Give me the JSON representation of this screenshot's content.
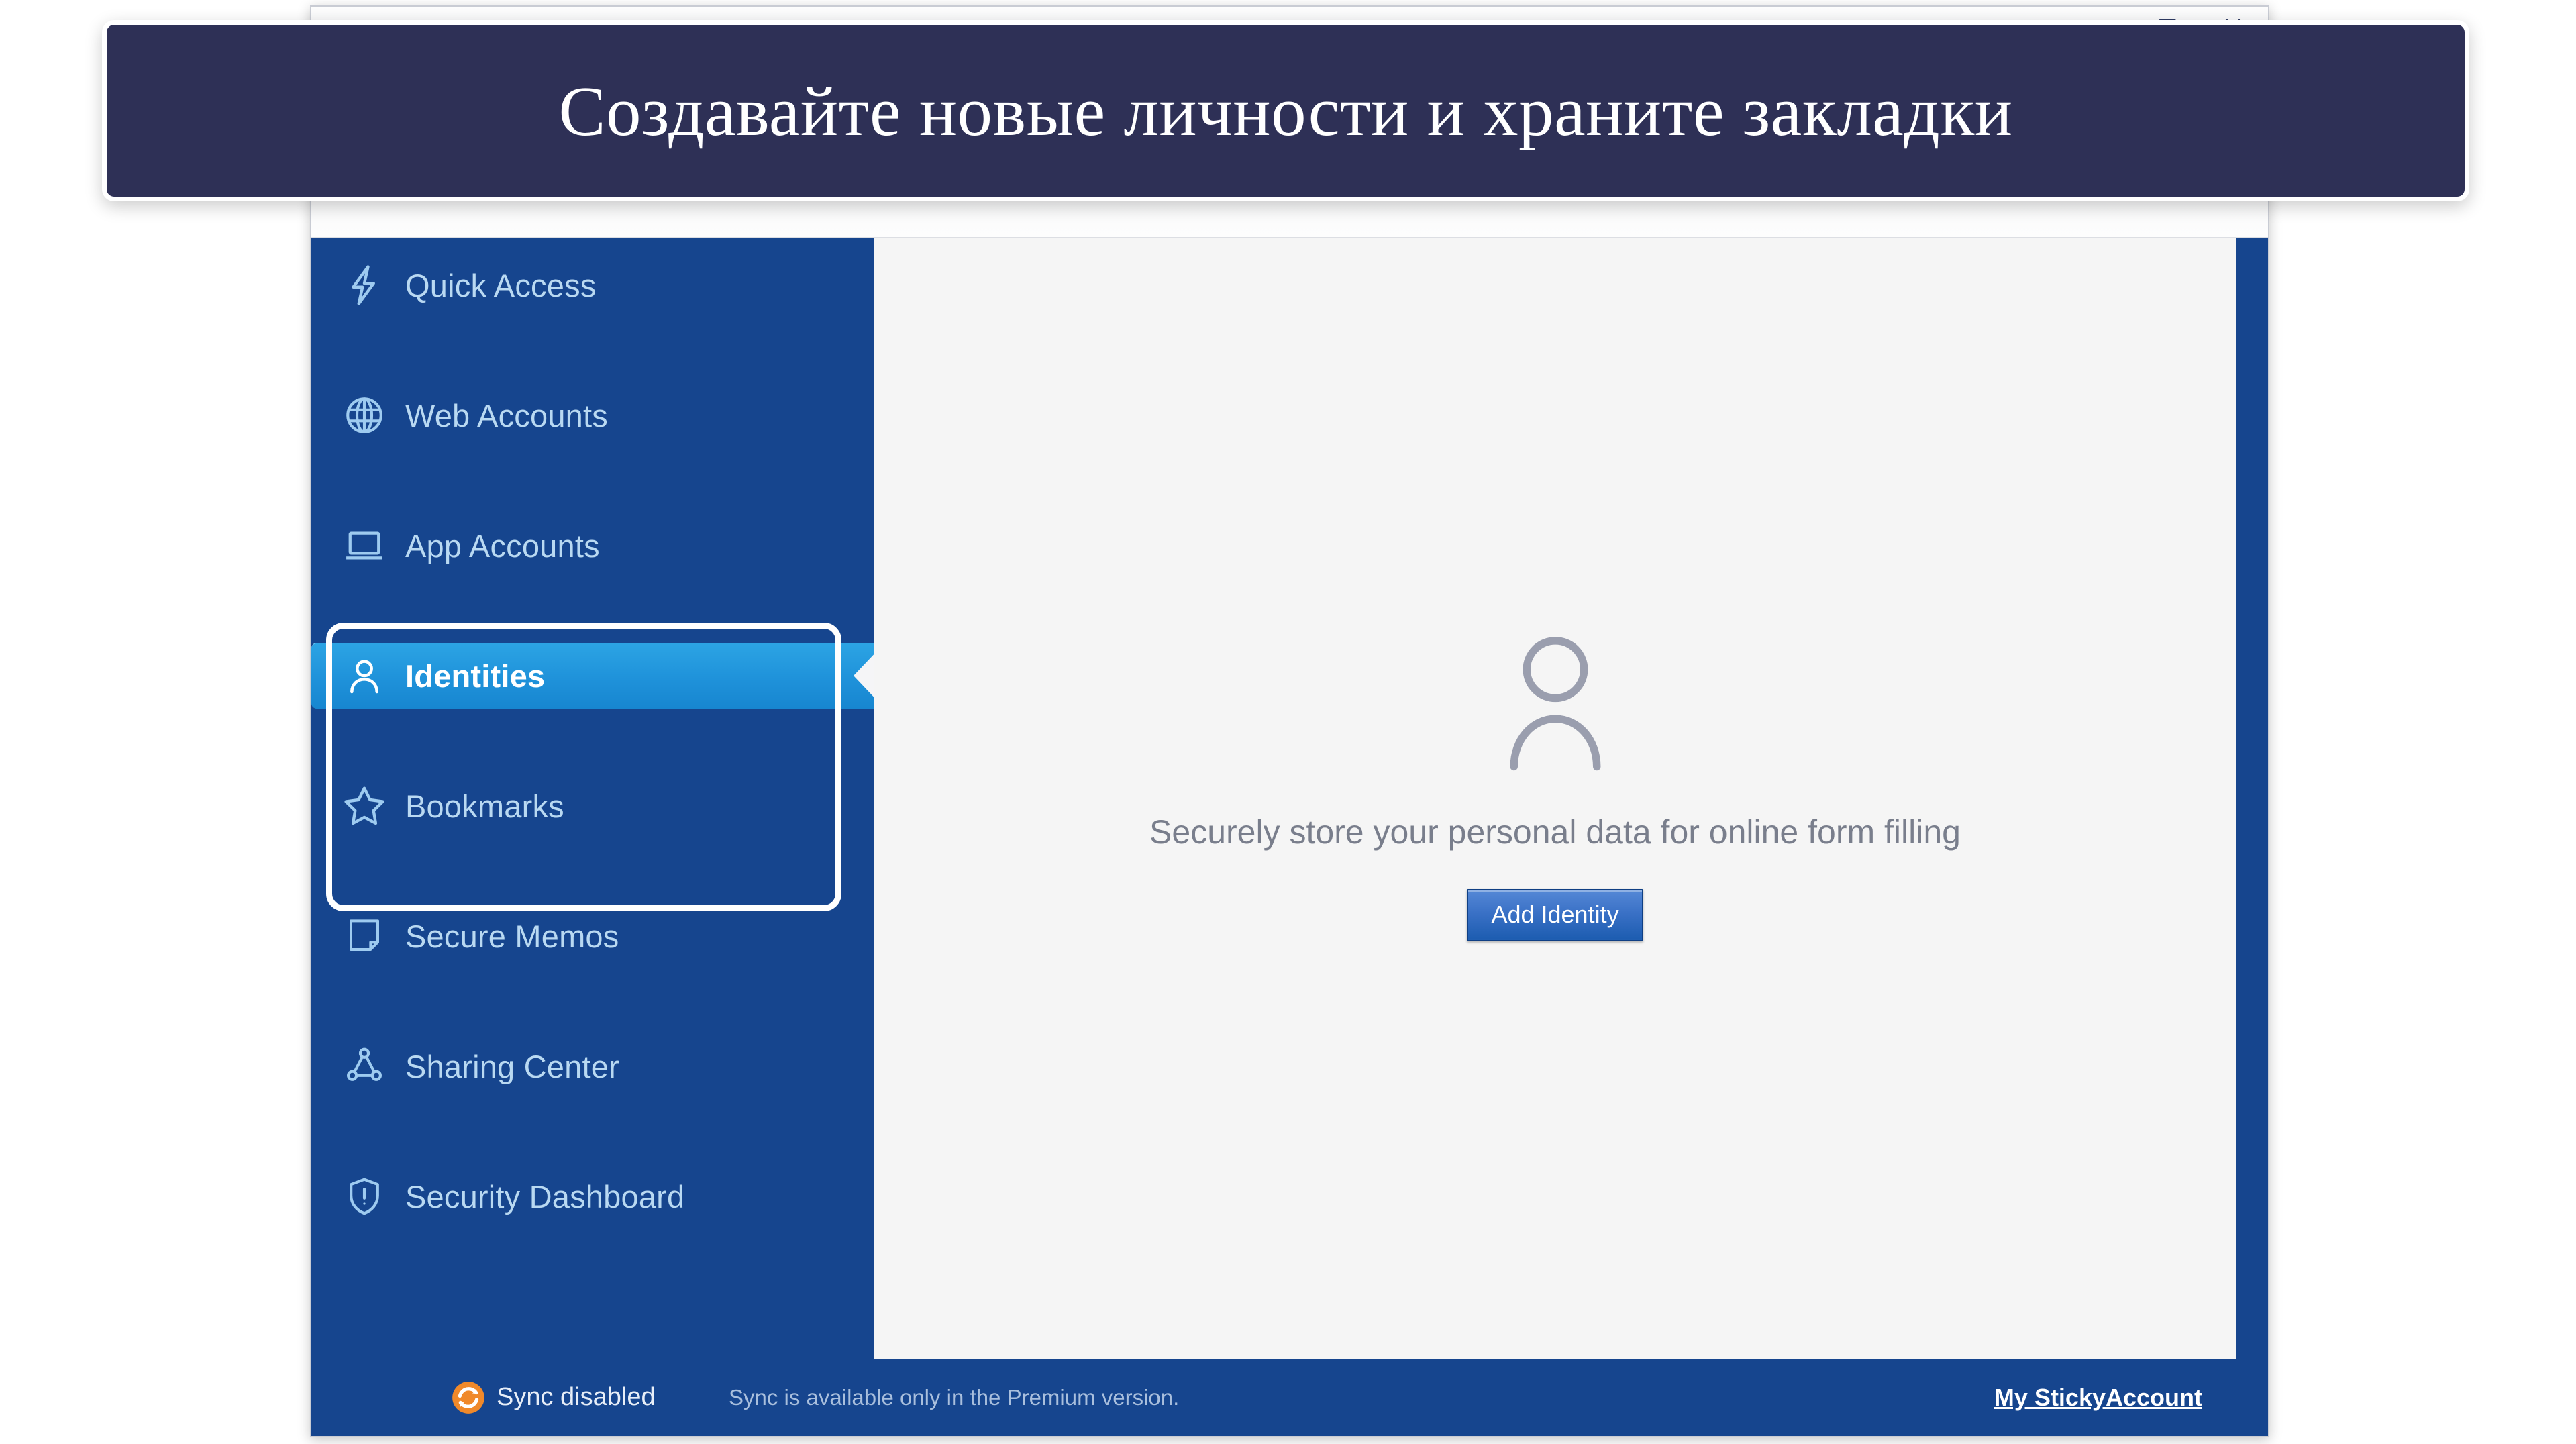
{
  "promo": {
    "text": "Создавайте новые личности и храните закладки"
  },
  "window": {
    "controls": [
      {
        "name": "maximize",
        "icon": "maximize-icon"
      },
      {
        "name": "close",
        "icon": "close-icon"
      }
    ]
  },
  "sidebar": {
    "items": [
      {
        "label": "Quick Access",
        "icon": "lightning-bolt-icon",
        "active": false
      },
      {
        "label": "Web Accounts",
        "icon": "globe-icon",
        "active": false
      },
      {
        "label": "App Accounts",
        "icon": "laptop-icon",
        "active": false
      },
      {
        "label": "Identities",
        "icon": "person-icon",
        "active": true
      },
      {
        "label": "Bookmarks",
        "icon": "star-icon",
        "active": false
      },
      {
        "label": "Secure Memos",
        "icon": "note-icon",
        "active": false
      },
      {
        "label": "Sharing Center",
        "icon": "share-nodes-icon",
        "active": false
      },
      {
        "label": "Security Dashboard",
        "icon": "shield-alert-icon",
        "active": false
      }
    ]
  },
  "main": {
    "empty_icon": "person-outline-icon",
    "empty_message": "Securely store your personal data for online form filling",
    "add_button_label": "Add Identity"
  },
  "footer": {
    "sync_icon": "sync-disabled-icon",
    "sync_status": "Sync disabled",
    "premium_note": "Sync is available only in the Premium version.",
    "account_link": "My StickyAccount"
  },
  "colors": {
    "sidebar_blue": "#16458e",
    "active_blue": "#2ca4e4",
    "banner_navy": "#2e3056",
    "button_blue": "#3a71c6",
    "sync_orange": "#f0892a",
    "content_bg": "#f5f5f5"
  }
}
